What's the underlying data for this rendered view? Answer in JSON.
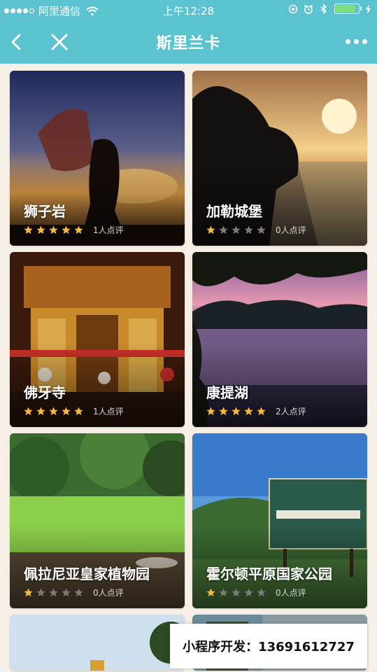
{
  "status_bar": {
    "carrier": "阿里通信",
    "time": "上午12:28",
    "battery_color": "#7ee07a"
  },
  "nav": {
    "title": "斯里兰卡",
    "back_icon": "chevron-left-icon",
    "close_icon": "close-icon",
    "more_icon": "more-icon"
  },
  "theme": {
    "accent": "#5bc3cf",
    "star_on": "#f5b940",
    "star_off": "#7a7a7a"
  },
  "places": [
    {
      "name": "狮子岩",
      "rating": 5,
      "reviews": "1人点评",
      "scene": "sunset-silhouette"
    },
    {
      "name": "加勒城堡",
      "rating": 1,
      "reviews": "0人点评",
      "scene": "sea-sunset"
    },
    {
      "name": "佛牙寺",
      "rating": 5,
      "reviews": "1人点评",
      "scene": "golden-temple"
    },
    {
      "name": "康提湖",
      "rating": 5,
      "reviews": "2人点评",
      "scene": "lake-dusk"
    },
    {
      "name": "佩拉尼亚皇家植物园",
      "rating": 1,
      "reviews": "0人点评",
      "scene": "garden-lawn"
    },
    {
      "name": "霍尔顿平原国家公园",
      "rating": 1,
      "reviews": "0人点评",
      "scene": "park-sign"
    },
    {
      "name": "",
      "rating": 0,
      "reviews": "",
      "scene": "partial-sky"
    },
    {
      "name": "",
      "rating": 0,
      "reviews": "",
      "scene": "partial-crowd"
    }
  ],
  "promo": {
    "text": "小程序开发：13691612727"
  }
}
